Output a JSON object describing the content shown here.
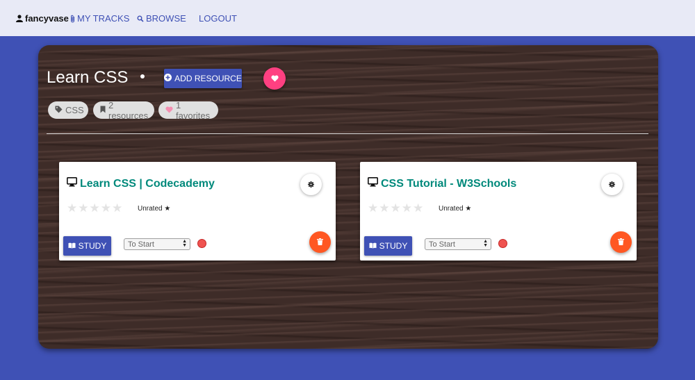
{
  "nav": {
    "username": "fancyvase",
    "my_tracks": "MY TRACKS",
    "browse": "BROWSE",
    "logout": "LOGOUT"
  },
  "track": {
    "title": "Learn CSS",
    "add_resource_label": "ADD RESOURCE",
    "chips": {
      "tag": "CSS",
      "resources": "2 resources",
      "favorites": "1 favorites"
    }
  },
  "resources": [
    {
      "title": "Learn CSS | Codecademy",
      "rating_label": "Unrated ★",
      "stars_filled": 0,
      "stars_total": 5,
      "study_label": "STUDY",
      "status": "To Start"
    },
    {
      "title": "CSS Tutorial - W3Schools",
      "rating_label": "Unrated ★",
      "stars_filled": 0,
      "stars_total": 5,
      "study_label": "STUDY",
      "status": "To Start"
    }
  ],
  "colors": {
    "primary": "#3f51b5",
    "accent_pink": "#ff4081",
    "delete_orange": "#ff5722",
    "title_teal": "#00897b",
    "nav_bg": "#e8eaf6",
    "panel_bg": "#3e2c28"
  },
  "icons": {
    "user": "user-icon",
    "tracks": "paperclip-icon",
    "browse": "search-icon",
    "add": "plus-circle-icon",
    "favorite": "heart-icon",
    "tag": "tag-icon",
    "bookmark": "bookmark-icon",
    "resource_type": "monitor-icon",
    "settings": "gear-icon",
    "study": "book-icon",
    "delete": "trash-icon"
  }
}
